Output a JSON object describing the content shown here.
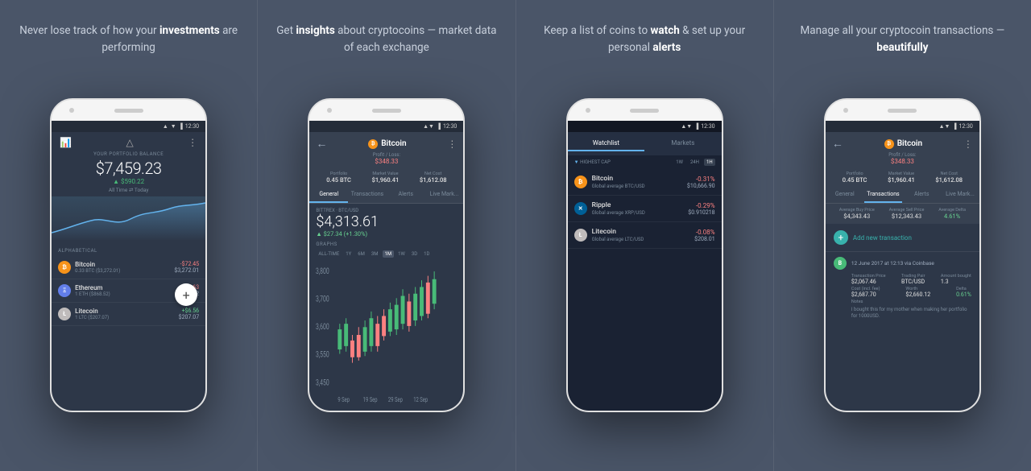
{
  "columns": [
    {
      "id": "col1",
      "text_plain": "Never lose track of how your ",
      "text_bold": "investments",
      "text_after": " are performing",
      "phone": {
        "status_time": "12:30",
        "header": {
          "label": "YOUR PORTFOLIO BALANCE",
          "balance": "$7,459.23",
          "change": "▲ $590.22",
          "period_left": "All Time",
          "period_right": "Today"
        },
        "section_label": "ALPHABETICAL",
        "coins": [
          {
            "symbol": "B",
            "name": "Bitcoin",
            "type": "btc",
            "sub": "0.33 BTC ($3,272.01)",
            "change": "-$72.45",
            "change_type": "neg",
            "price": "$3,272.01"
          },
          {
            "symbol": "E",
            "name": "Ethereum",
            "type": "eth",
            "sub": "1 ETH ($868.52)",
            "change": "-$8.63",
            "change_type": "neg",
            "price": "$868.52"
          },
          {
            "symbol": "L",
            "name": "Litecoin",
            "type": "ltc",
            "sub": "1 LTC ($207.07)",
            "change": "+$6.56",
            "change_type": "pos",
            "price": "$207.07"
          }
        ]
      }
    },
    {
      "id": "col2",
      "text_plain": "Get ",
      "text_bold": "insights",
      "text_after": " about cryptocoins — market data of each exchange",
      "phone": {
        "status_time": "12:30",
        "header": {
          "coin_name": "Bitcoin",
          "pl_label": "Profit / Loss:",
          "pl_value": "$348.33",
          "portfolio": "0.45 BTC",
          "market_value": "$1,960.41",
          "net_cost": "$1,612.08"
        },
        "tabs": [
          "General",
          "Transactions",
          "Alerts",
          "Live Mark..."
        ],
        "active_tab": 0,
        "exchange": "BITTREX · BTC/USD",
        "price": "$4,313.61",
        "price_change": "▲ $27.34 (+1.30%)",
        "graphs_label": "GRAPHS",
        "time_tabs": [
          "ALL-TIME",
          "1Y",
          "6M",
          "3M",
          "1M",
          "1W",
          "3D",
          "1D"
        ],
        "active_time": 4
      }
    },
    {
      "id": "col3",
      "text_plain": "Keep a list of coins to ",
      "text_bold": "watch",
      "text_middle": " & set up your personal ",
      "text_bold2": "alerts",
      "phone": {
        "status_time": "12:30",
        "tabs": [
          "Watchlist",
          "Markets"
        ],
        "active_tab": 0,
        "filter_label": "HIGHEST CAP",
        "time_filters": [
          "1W",
          "24H",
          "1H"
        ],
        "active_filter": 2,
        "coins": [
          {
            "symbol": "B",
            "type": "btc",
            "name": "Bitcoin",
            "pair": "Global average BTC/USD",
            "change": "-0.31%",
            "price": "$10,666.90"
          },
          {
            "symbol": "X",
            "type": "xrp",
            "name": "Ripple",
            "pair": "Global average XRP/USD",
            "change": "-0.29%",
            "price": "$0.910218"
          },
          {
            "symbol": "L",
            "type": "ltc",
            "name": "Litecoin",
            "pair": "Global average LTC/USD",
            "change": "-0.08%",
            "price": "$208.01"
          }
        ]
      }
    },
    {
      "id": "col4",
      "text_plain": "Manage all your cryptocoin transactions — ",
      "text_bold": "beautifully",
      "phone": {
        "status_time": "12:30",
        "header": {
          "coin_name": "Bitcoin",
          "pl_label": "Profit / Loss:",
          "pl_value": "$348.33",
          "portfolio": "0.45 BTC",
          "market_value": "$1,960.41",
          "net_cost": "$1,612.08"
        },
        "tabs": [
          "General",
          "Transactions",
          "Alerts",
          "Live Mark..."
        ],
        "active_tab": 1,
        "stats": {
          "avg_buy_label": "Average Buy Price",
          "avg_buy": "$4,343.43",
          "avg_sell_label": "Average Sell Price",
          "avg_sell": "$12,343.43",
          "avg_delta_label": "Average Delta",
          "avg_delta": "4.61%"
        },
        "add_label": "Add new transaction",
        "transaction": {
          "avatar": "B",
          "date": "12 June 2017 at 12:13 via Coinbase",
          "tx_price_label": "Transaction Price",
          "tx_price": "$2,067.46",
          "trading_pair_label": "Trading Pair",
          "trading_pair": "BTC/USD",
          "amount_label": "Amount bought",
          "amount": "1.3",
          "cost_label": "Cost (incl. fee)",
          "cost": "$2,687.70",
          "worth_label": "Worth",
          "worth": "$2,660.12",
          "delta_label": "Delta",
          "delta": "0.61%",
          "notes_label": "Notes",
          "notes": "I bought this for my mother when making her portfolio for 1000USD."
        }
      }
    }
  ]
}
